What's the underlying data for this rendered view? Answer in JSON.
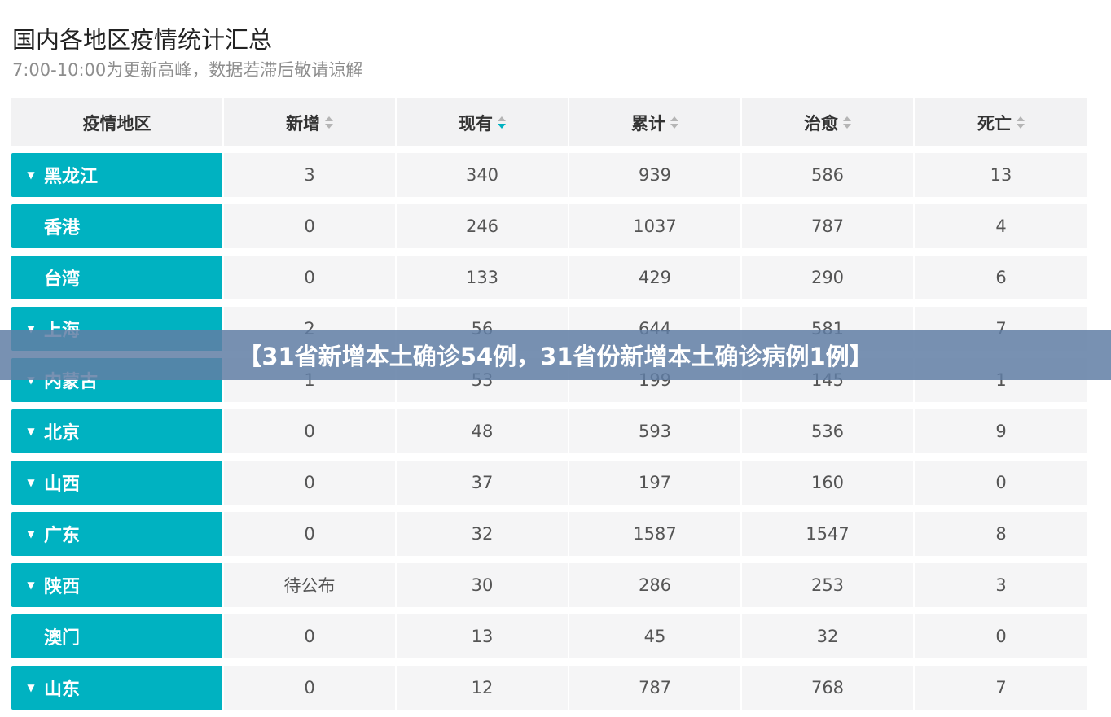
{
  "page": {
    "title": "国内各地区疫情统计汇总",
    "subtitle": "7:00-10:00为更新高峰，数据若滞后敬请谅解"
  },
  "table": {
    "headers": [
      "疫情地区",
      "新增",
      "现有",
      "累计",
      "治愈",
      "死亡"
    ],
    "active_sort_column": "现有",
    "rows": [
      {
        "region": "黑龙江",
        "expandable": true,
        "values": [
          "3",
          "340",
          "939",
          "586",
          "13"
        ]
      },
      {
        "region": "香港",
        "expandable": false,
        "values": [
          "0",
          "246",
          "1037",
          "787",
          "4"
        ]
      },
      {
        "region": "台湾",
        "expandable": false,
        "values": [
          "0",
          "133",
          "429",
          "290",
          "6"
        ]
      },
      {
        "region": "上海",
        "expandable": true,
        "values": [
          "2",
          "56",
          "644",
          "581",
          "7"
        ]
      },
      {
        "region": "内蒙古",
        "expandable": true,
        "values": [
          "1",
          "53",
          "199",
          "145",
          "1"
        ]
      },
      {
        "region": "北京",
        "expandable": true,
        "values": [
          "0",
          "48",
          "593",
          "536",
          "9"
        ]
      },
      {
        "region": "山西",
        "expandable": true,
        "values": [
          "0",
          "37",
          "197",
          "160",
          "0"
        ]
      },
      {
        "region": "广东",
        "expandable": true,
        "values": [
          "0",
          "32",
          "1587",
          "1547",
          "8"
        ]
      },
      {
        "region": "陕西",
        "expandable": true,
        "values": [
          "待公布",
          "30",
          "286",
          "253",
          "3"
        ]
      },
      {
        "region": "澳门",
        "expandable": false,
        "values": [
          "0",
          "13",
          "45",
          "32",
          "0"
        ]
      },
      {
        "region": "山东",
        "expandable": true,
        "values": [
          "0",
          "12",
          "787",
          "768",
          "7"
        ]
      }
    ]
  },
  "banner": {
    "text": "【31省新增本土确诊54例，31省份新增本土确诊病例1例】"
  },
  "colors": {
    "accent": "#00b2c1",
    "row_bg": "#f5f5f6",
    "banner_bg": "#607ea4"
  },
  "icons": {
    "sort": "sort-icon",
    "expand": "caret-down-icon"
  }
}
